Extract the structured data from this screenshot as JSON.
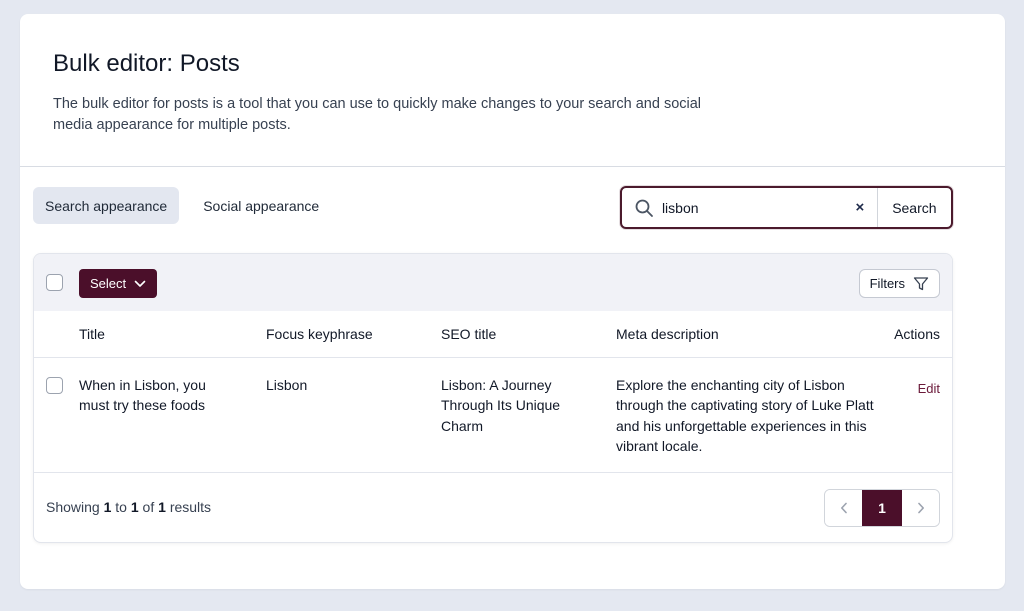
{
  "header": {
    "title": "Bulk editor: Posts",
    "description": "The bulk editor for posts is a tool that you can use to quickly make changes to your search and social media appearance for multiple posts."
  },
  "tabs": [
    {
      "label": "Search appearance",
      "active": true
    },
    {
      "label": "Social appearance",
      "active": false
    }
  ],
  "search": {
    "value": "lisbon",
    "clear_icon": "×",
    "button_label": "Search"
  },
  "toolbar": {
    "select_label": "Select",
    "filters_label": "Filters"
  },
  "table": {
    "columns": [
      "Title",
      "Focus keyphrase",
      "SEO title",
      "Meta description",
      "Actions"
    ],
    "rows": [
      {
        "title": "When in Lisbon, you must try these foods",
        "focus_keyphrase": "Lisbon",
        "seo_title": "Lisbon: A Journey Through Its Unique Charm",
        "meta_description": "Explore the enchanting city of Lisbon through the captivating story of Luke Platt and his unforgettable experiences in this vibrant locale.",
        "action": "Edit"
      }
    ]
  },
  "footer": {
    "showing_prefix": "Showing",
    "from": "1",
    "to_word": "to",
    "to": "1",
    "of_word": "of",
    "total": "1",
    "suffix": "results"
  },
  "pagination": {
    "current_page": "1"
  },
  "colors": {
    "accent": "#4b0f2a",
    "background": "#e4e8f1"
  }
}
